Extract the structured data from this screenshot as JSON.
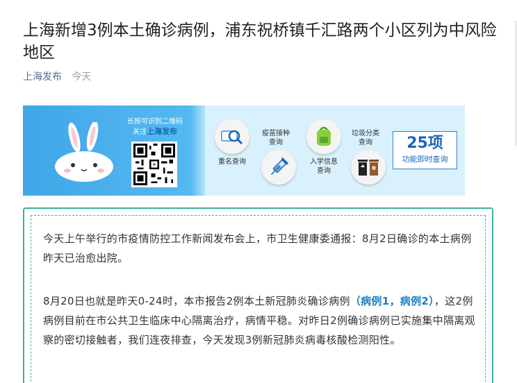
{
  "article": {
    "title": "上海新增3例本土确诊病例，浦东祝桥镇千汇路两个小区列为中风险地区",
    "account": "上海发布",
    "date": "今天"
  },
  "banner": {
    "scan_line1": "长按可识别二维码",
    "scan_line2_prefix": "关注",
    "scan_account": "上海发布",
    "services": [
      {
        "label": "重名查询",
        "icon": "magnifier-id-icon"
      },
      {
        "label": "疫苗接种\n查询",
        "icon": "syringe-icon"
      },
      {
        "label": "入学信息\n查询",
        "icon": "schoolbag-icon"
      },
      {
        "label": "垃圾分类\n查询",
        "icon": "trash-bins-icon"
      }
    ],
    "count_num": "25项",
    "count_sub": "功能即时查询"
  },
  "content": {
    "p1": "今天上午举行的市疫情防控工作新闻发布会上，市卫生健康委通报：8月2日确诊的本土病例昨天已治愈出院。",
    "p2_a": "8月20日也就是昨天0-24时，本市报告2例本土新冠肺炎确诊病例",
    "p2_link": "（病例1，病例2）",
    "p2_b": "，这2例病例目前在市公共卫生临床中心隔离治疗，病情平稳。对昨日2例确诊病例已实施集中隔离观察的密切接触者，我们连夜排查，今天发现3例新冠肺炎病毒核酸检测阳性。"
  },
  "colors": {
    "account_link": "#576b95",
    "card_border": "#3ab19b",
    "highlight": "#1a7fc1",
    "banner_blue": "#3fa6e8"
  }
}
